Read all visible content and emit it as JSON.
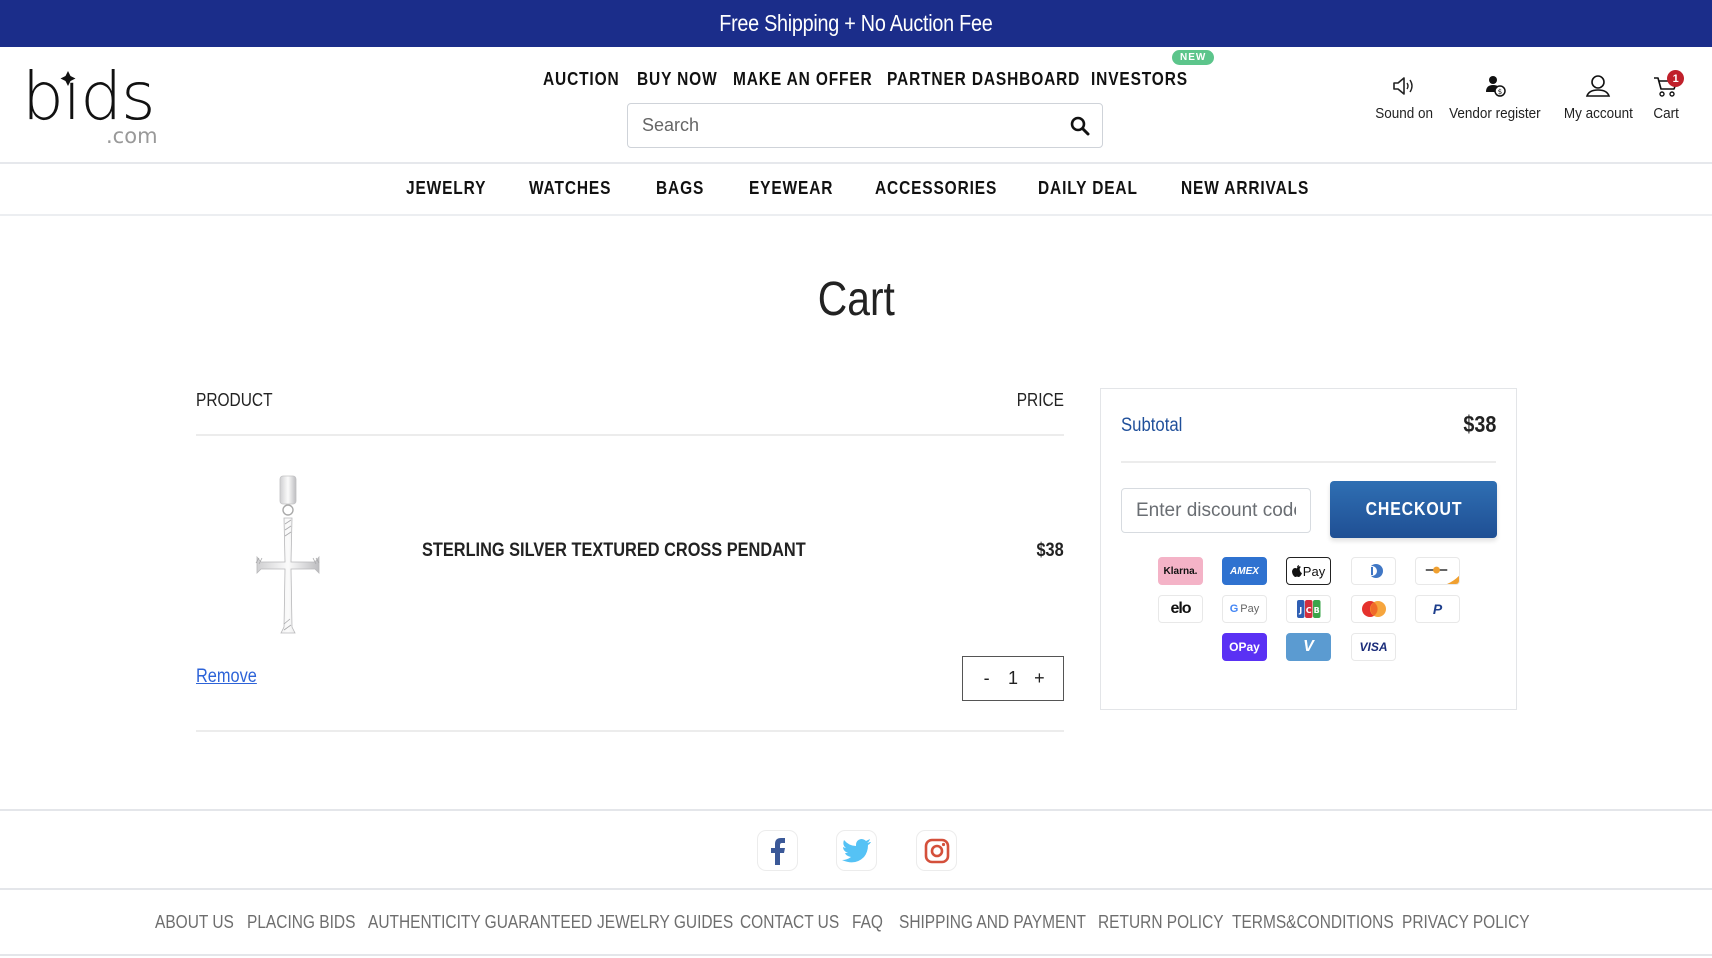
{
  "promo": {
    "text": "Free Shipping + No Auction Fee"
  },
  "header": {
    "logo": {
      "main": "bids",
      "sub": ".com"
    },
    "top_nav": [
      {
        "label": "AUCTION"
      },
      {
        "label": "BUY NOW"
      },
      {
        "label": "MAKE AN OFFER"
      },
      {
        "label": "PARTNER DASHBOARD"
      },
      {
        "label": "INVESTORS",
        "badge": "NEW"
      }
    ],
    "search": {
      "placeholder": "Search",
      "value": "",
      "icon": "search-icon"
    },
    "utilities": [
      {
        "label": "Sound on",
        "icon": "speaker-icon"
      },
      {
        "label": "Vendor register",
        "icon": "vendor-user-icon"
      },
      {
        "label": "My account",
        "icon": "user-icon"
      },
      {
        "label": "Cart",
        "icon": "cart-icon",
        "badge": "1"
      }
    ]
  },
  "category_nav": [
    {
      "label": "JEWELRY"
    },
    {
      "label": "WATCHES"
    },
    {
      "label": "BAGS"
    },
    {
      "label": "EYEWEAR"
    },
    {
      "label": "ACCESSORIES"
    },
    {
      "label": "DAILY DEAL"
    },
    {
      "label": "NEW ARRIVALS"
    }
  ],
  "page": {
    "title": "Cart"
  },
  "cart": {
    "columns": {
      "product": "PRODUCT",
      "price": "PRICE"
    },
    "items": [
      {
        "name": "STERLING SILVER TEXTURED CROSS PENDANT",
        "price": "$38",
        "quantity": "1",
        "remove_label": "Remove",
        "decrement_label": "-",
        "increment_label": "+"
      }
    ]
  },
  "summary": {
    "subtotal_label": "Subtotal",
    "subtotal_value": "$38",
    "discount_placeholder": "Enter discount code",
    "checkout_label": "CHECKOUT",
    "payment_methods": [
      {
        "name": "Klarna",
        "label": "Klarna."
      },
      {
        "name": "American Express",
        "label": "AMEX"
      },
      {
        "name": "Apple Pay",
        "label": "Pay"
      },
      {
        "name": "Diners Club",
        "label": ""
      },
      {
        "name": "Discover",
        "label": ""
      },
      {
        "name": "Elo",
        "label": "elo"
      },
      {
        "name": "Google Pay",
        "label": "G Pay"
      },
      {
        "name": "JCB",
        "label": "JCB"
      },
      {
        "name": "Mastercard",
        "label": ""
      },
      {
        "name": "PayPal",
        "label": "P"
      },
      {
        "name": "Shop Pay",
        "label": "OPay"
      },
      {
        "name": "Venmo",
        "label": "V"
      },
      {
        "name": "Visa",
        "label": "VISA"
      }
    ]
  },
  "footer": {
    "social": [
      {
        "name": "Facebook",
        "color": "#3b5998"
      },
      {
        "name": "Twitter",
        "color": "#55c2f5"
      },
      {
        "name": "Instagram",
        "color": "#d4503b"
      }
    ],
    "links": [
      {
        "label": "ABOUT US"
      },
      {
        "label": "PLACING BIDS"
      },
      {
        "label": "AUTHENTICITY GUARANTEED"
      },
      {
        "label": "JEWELRY GUIDES"
      },
      {
        "label": "CONTACT US"
      },
      {
        "label": "FAQ"
      },
      {
        "label": "SHIPPING AND PAYMENT"
      },
      {
        "label": "RETURN POLICY"
      },
      {
        "label": "TERMS&CONDITIONS"
      },
      {
        "label": "PRIVACY POLICY"
      }
    ]
  },
  "colors": {
    "promo_bg": "#1b2d8a",
    "accent_blue": "#1f4f9a",
    "link_blue": "#2d63d8",
    "badge_red": "#c0202b",
    "badge_green": "#5cc58b"
  }
}
